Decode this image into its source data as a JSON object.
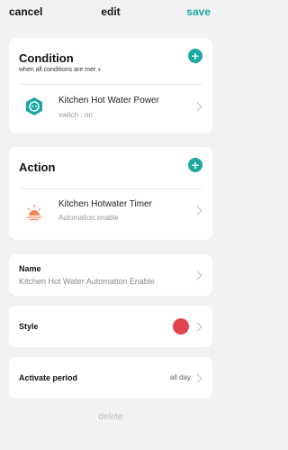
{
  "header": {
    "cancel_label": "cancel",
    "title": "edit",
    "save_label": "save"
  },
  "condition": {
    "title": "Condition",
    "mode_label": "when all conditions are met",
    "items": [
      {
        "title": "Kitchen Hot Water Power",
        "subtitle": "switch : on",
        "icon": "smart-plug-icon"
      }
    ]
  },
  "action": {
    "title": "Action",
    "items": [
      {
        "title": "Kitchen Hotwater Timer",
        "subtitle": "Automation:enable",
        "icon": "sunrise-scene-icon"
      }
    ]
  },
  "name": {
    "label": "Name",
    "value": "Kitchen Hot Water Automation Enable"
  },
  "style": {
    "label": "Style",
    "color": "#e0444f"
  },
  "period": {
    "label": "Activate period",
    "value": "all day"
  },
  "delete_label": "delete",
  "colors": {
    "accent": "#1aa8a0"
  }
}
